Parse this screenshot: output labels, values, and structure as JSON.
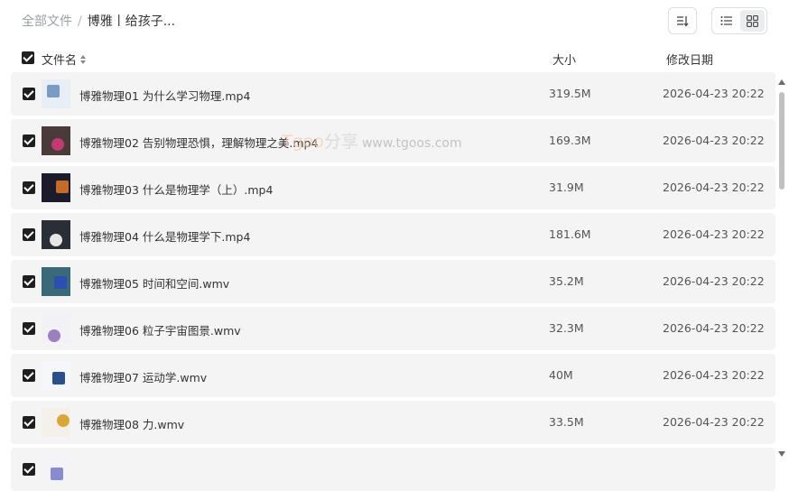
{
  "breadcrumb": {
    "root": "全部文件",
    "separator": "/",
    "current": "博雅丨给孩子..."
  },
  "toolbar": {
    "sort_icon": "sort-icon",
    "list_view_icon": "list-view-icon",
    "grid_view_icon": "grid-view-icon",
    "active_view": "list"
  },
  "columns": {
    "name": "文件名",
    "size": "大小",
    "modified": "修改日期"
  },
  "watermark": {
    "brand": "Tgoo",
    "text": "分享",
    "url": "www.tgoos.com"
  },
  "files": [
    {
      "name": "博雅物理01 为什么学习物理.mp4",
      "size": "319.5M",
      "modified": "2026-04-23 20:22",
      "checked": true,
      "thumb": [
        "#e8eef5",
        "#7a9bc4"
      ]
    },
    {
      "name": "博雅物理02 告别物理恐惧，理解物理之美.mp4",
      "size": "169.3M",
      "modified": "2026-04-23 20:22",
      "checked": true,
      "thumb": [
        "#4a3a3a",
        "#c23b6e"
      ]
    },
    {
      "name": "博雅物理03 什么是物理学（上）.mp4",
      "size": "31.9M",
      "modified": "2026-04-23 20:22",
      "checked": true,
      "thumb": [
        "#1b1b2a",
        "#c46a2a"
      ]
    },
    {
      "name": "博雅物理04 什么是物理学下.mp4",
      "size": "181.6M",
      "modified": "2026-04-23 20:22",
      "checked": true,
      "thumb": [
        "#2a2e36",
        "#e6e6e6"
      ]
    },
    {
      "name": "博雅物理05 时间和空间.wmv",
      "size": "35.2M",
      "modified": "2026-04-23 20:22",
      "checked": true,
      "thumb": [
        "#3a6a7a",
        "#2e4fb0"
      ]
    },
    {
      "name": "博雅物理06 粒子宇宙图景.wmv",
      "size": "32.3M",
      "modified": "2026-04-23 20:22",
      "checked": true,
      "thumb": [
        "#f2f2f6",
        "#9b7fc0"
      ]
    },
    {
      "name": "博雅物理07 运动学.wmv",
      "size": "40M",
      "modified": "2026-04-23 20:22",
      "checked": true,
      "thumb": [
        "#f5f7fb",
        "#2b4f8a"
      ]
    },
    {
      "name": "博雅物理08 力.wmv",
      "size": "33.5M",
      "modified": "2026-04-23 20:22",
      "checked": true,
      "thumb": [
        "#f4f1ea",
        "#d9a63a"
      ]
    },
    {
      "name": "",
      "size": "",
      "modified": "",
      "checked": true,
      "thumb": [
        "#f4f4f8",
        "#8a8ad0"
      ]
    }
  ]
}
